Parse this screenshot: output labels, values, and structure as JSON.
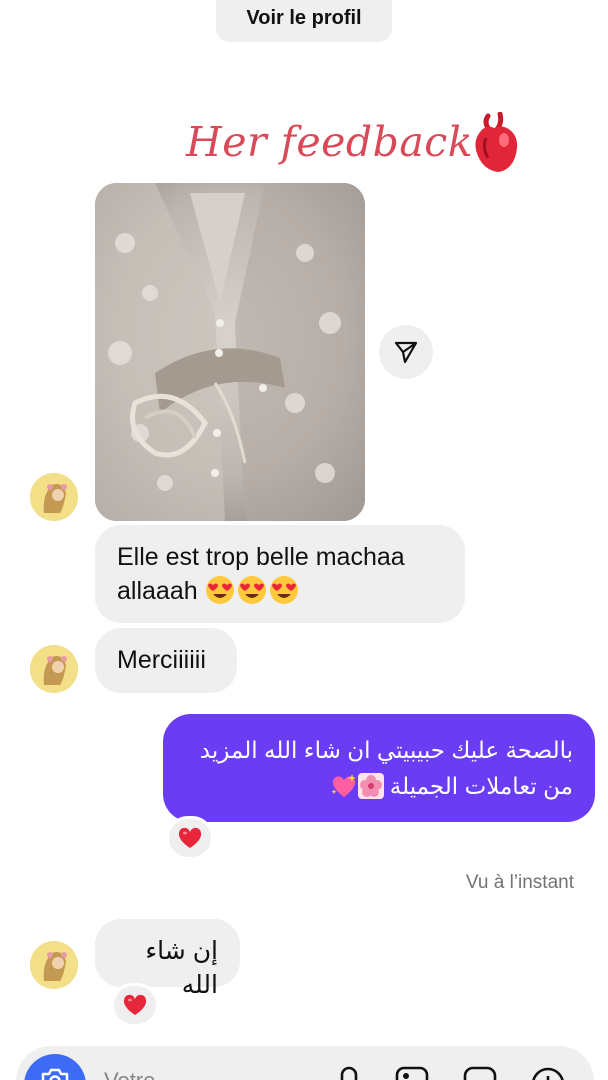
{
  "header": {
    "view_profile_label": "Voir le profil"
  },
  "story_overlay": {
    "caption": "Her feedback"
  },
  "messages": [
    {
      "text": "Elle est trop belle machaa allaaah"
    },
    {
      "text": "Merciiiiii"
    },
    {
      "line1": "بالصحة عليك حبيبيتي ان شاء الله المزيد",
      "line2": "من تعاملات الجميلة"
    },
    {
      "text": "إن شاء الله"
    }
  ],
  "seen_status": "Vu à l’instant",
  "composer": {
    "placeholder": "Votre message..."
  },
  "colors": {
    "accent_bubble": "#6a3cf4",
    "caption": "#d94a58",
    "camera_button": "#3d6bf5",
    "incoming_bubble": "#efefef"
  },
  "icons": [
    "share-icon",
    "camera-icon",
    "microphone-icon",
    "gallery-icon",
    "sticker-icon",
    "add-icon",
    "heart-reaction-icon",
    "heart-eyes-emoji",
    "anatomical-heart-emoji"
  ]
}
